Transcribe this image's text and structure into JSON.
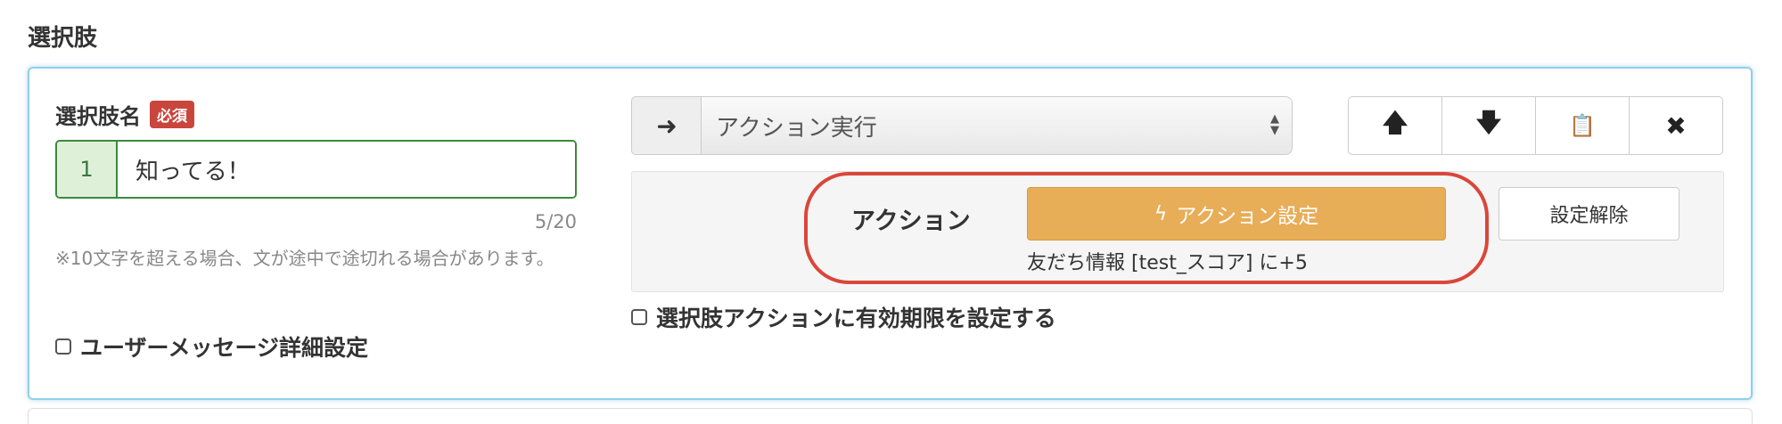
{
  "section": {
    "title": "選択肢"
  },
  "choice": {
    "label": "選択肢名",
    "required": "必須",
    "index": "1",
    "value": "知ってる！",
    "char_count": "5/20",
    "note": "※10文字を超える場合、文が途中で途切れる場合があります。",
    "user_message_checkbox": "ユーザーメッセージ詳細設定"
  },
  "action_select": {
    "arrow_icon": "arrow-right-icon",
    "selected": "アクション実行"
  },
  "toolbar": {
    "buttons": [
      {
        "icon": "arrow-up-icon",
        "glyph": "🡅"
      },
      {
        "icon": "arrow-down-icon",
        "glyph": "🡇"
      },
      {
        "icon": "paste-icon",
        "glyph": "📋"
      },
      {
        "icon": "close-icon",
        "glyph": "✖"
      }
    ]
  },
  "action": {
    "label": "アクション",
    "button_label": "アクション設定",
    "summary": "友だち情報 [test_スコア] に+5",
    "unset_label": "設定解除",
    "expire_checkbox": "選択肢アクションに有効期限を設定する"
  },
  "colors": {
    "accent_border": "#8fd0ea",
    "required_badge": "#c9463d",
    "action_button": "#e8ad57",
    "highlight": "#d9473a",
    "input_border": "#3c8a3c"
  }
}
